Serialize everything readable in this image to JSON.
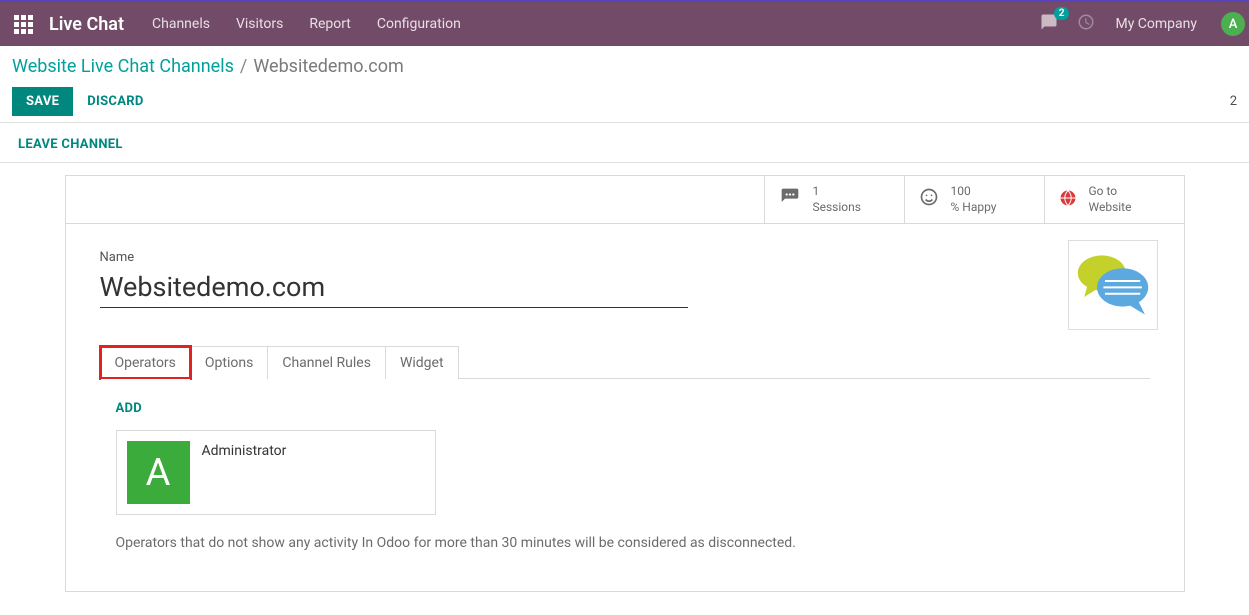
{
  "topnav": {
    "app_title": "Live Chat",
    "menu": [
      "Channels",
      "Visitors",
      "Report",
      "Configuration"
    ],
    "message_count": "2",
    "company": "My Company",
    "avatar_letter": "A"
  },
  "breadcrumb": {
    "parent": "Website Live Chat Channels",
    "sep": "/",
    "current": "Websitedemo.com"
  },
  "actions": {
    "save": "SAVE",
    "discard": "DISCARD",
    "count": "2",
    "leave": "LEAVE CHANNEL"
  },
  "stats": {
    "sessions_num": "1",
    "sessions_label": "Sessions",
    "happy_num": "100",
    "happy_label": "% Happy",
    "goto_line1": "Go to",
    "goto_line2": "Website"
  },
  "form": {
    "name_label": "Name",
    "name_value": "Websitedemo.com"
  },
  "tabs": {
    "operators": "Operators",
    "options": "Options",
    "channel_rules": "Channel Rules",
    "widget": "Widget"
  },
  "operators": {
    "add": "ADD",
    "list": [
      {
        "initial": "A",
        "name": "Administrator"
      }
    ],
    "note": "Operators that do not show any activity In Odoo for more than 30 minutes will be considered as disconnected."
  }
}
